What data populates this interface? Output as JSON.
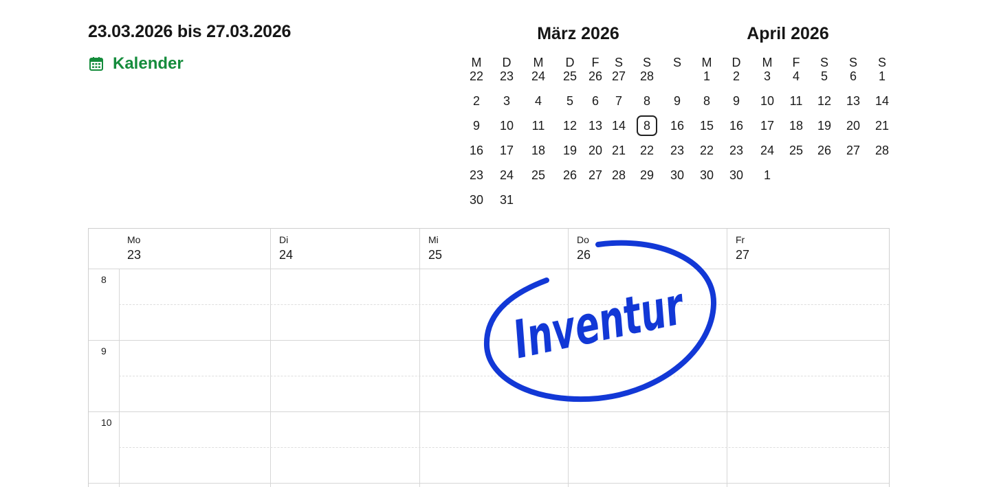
{
  "header": {
    "range_title": "23.03.2026 bis 27.03.2026",
    "calendar_link_label": "Kalender",
    "calendar_link_color": "#158c3c"
  },
  "mini_calendars": [
    {
      "title": "März 2026",
      "weekdays": [
        "M",
        "D",
        "M",
        "D",
        "F",
        "S",
        "S"
      ],
      "weeks": [
        [
          "22",
          "23",
          "24",
          "25",
          "26",
          "27",
          "28"
        ],
        [
          "2",
          "3",
          "4",
          "5",
          "6",
          "7",
          "8"
        ],
        [
          "9",
          "10",
          "11",
          "12",
          "13",
          "14",
          "8"
        ],
        [
          "16",
          "17",
          "18",
          "19",
          "20",
          "21",
          "22"
        ],
        [
          "23",
          "24",
          "25",
          "26",
          "27",
          "28",
          "29"
        ],
        [
          "30",
          "31",
          "",
          "",
          "",
          "",
          ""
        ]
      ],
      "highlighted": "8"
    },
    {
      "title": "April 2026",
      "weekdays": [
        "S",
        "M",
        "D",
        "M",
        "F",
        "S",
        "S",
        "S"
      ],
      "weeks": [
        [
          "",
          "1",
          "2",
          "3",
          "4",
          "5",
          "6",
          "1"
        ],
        [
          "9",
          "8",
          "9",
          "10",
          "11",
          "12",
          "13",
          "14"
        ],
        [
          "16",
          "15",
          "16",
          "17",
          "18",
          "19",
          "20",
          "21"
        ],
        [
          "23",
          "22",
          "23",
          "24",
          "25",
          "26",
          "27",
          "28"
        ],
        [
          "30",
          "30",
          "30",
          "1",
          "",
          "",
          "",
          ""
        ],
        [
          "",
          "",
          "",
          "",
          "",
          "",
          "",
          ""
        ]
      ]
    }
  ],
  "week": {
    "days": [
      {
        "name": "Mo",
        "date": "23"
      },
      {
        "name": "Di",
        "date": "24"
      },
      {
        "name": "Mi",
        "date": "25"
      },
      {
        "name": "Do",
        "date": "26"
      },
      {
        "name": "Fr",
        "date": "27"
      }
    ],
    "hours": [
      "8",
      "9",
      "10"
    ]
  },
  "stamp": {
    "text": "Inventur",
    "color": "#1238d6"
  }
}
